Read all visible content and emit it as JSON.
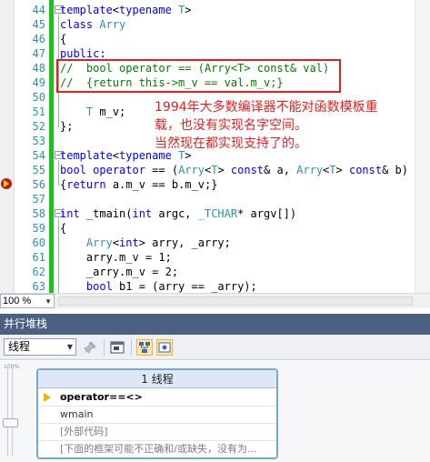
{
  "editor": {
    "lines": [
      {
        "n": "44",
        "text": "template<typename T>"
      },
      {
        "n": "45",
        "text": "class Arry"
      },
      {
        "n": "46",
        "text": "{"
      },
      {
        "n": "47",
        "text": "public:"
      },
      {
        "n": "48",
        "text": "//  bool operator == (Arry<T> const& val)"
      },
      {
        "n": "49",
        "text": "//  {return this->m_v == val.m_v;}"
      },
      {
        "n": "50",
        "text": ""
      },
      {
        "n": "51",
        "text": "    T m_v;"
      },
      {
        "n": "52",
        "text": "};"
      },
      {
        "n": "53",
        "text": ""
      },
      {
        "n": "54",
        "text": "template<typename T>"
      },
      {
        "n": "55",
        "text": "bool operator == (Arry<T> const& a, Arry<T> const& b)"
      },
      {
        "n": "56",
        "text": "{return a.m_v == b.m_v;}"
      },
      {
        "n": "57",
        "text": ""
      },
      {
        "n": "58",
        "text": "int _tmain(int argc, _TCHAR* argv[])"
      },
      {
        "n": "59",
        "text": "{"
      },
      {
        "n": "60",
        "text": "    Arry<int> arry, _arry;"
      },
      {
        "n": "61",
        "text": "    arry.m_v = 1;"
      },
      {
        "n": "62",
        "text": "    _arry.m_v = 2;"
      },
      {
        "n": "63",
        "text": "    bool b1 = (arry == _arry);"
      }
    ],
    "annotation": {
      "line1": "1994年大多数编译器不能对函数模板重",
      "line2": "载，也没有实现名字空间。",
      "line3": "当然现在都实现支持了的。"
    },
    "zoom_level": "100 %"
  },
  "panel": {
    "title": "并行堆栈",
    "thread_select": "线程",
    "zoom_label": "100%",
    "node": {
      "header": "1 线程",
      "frames": [
        "operator==<>",
        "wmain",
        "[外部代码]",
        "[下面的框架可能不正确和/或缺失，没有为..."
      ]
    }
  },
  "colors": {
    "keyword": "#0000ff",
    "type": "#2b91af",
    "comment": "#008000",
    "annotation": "#e12121",
    "panel_header": "#4d6082"
  }
}
